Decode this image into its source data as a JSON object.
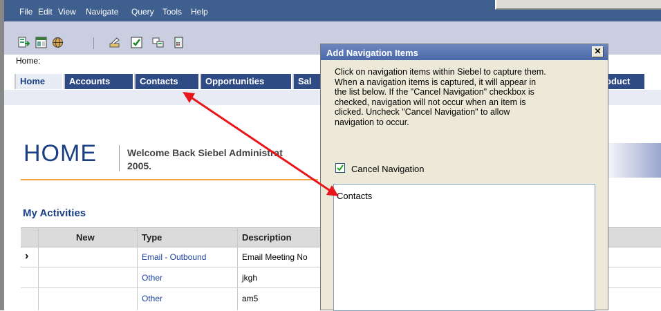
{
  "menu": {
    "items": [
      "File",
      "Edit",
      "View",
      "Navigate",
      "Query",
      "Tools",
      "Help"
    ]
  },
  "toolbar": {
    "icons": [
      "export-icon",
      "layout-icon",
      "globe-icon",
      "edit-icon",
      "checklist-icon",
      "screen-icon",
      "calculator-icon"
    ]
  },
  "breadcrumb": "Home:",
  "tabs": [
    {
      "label": "Home",
      "active": true
    },
    {
      "label": "Accounts",
      "active": false
    },
    {
      "label": "Contacts",
      "active": false
    },
    {
      "label": "Opportunities",
      "active": false
    },
    {
      "label": "Sal",
      "active": false
    },
    {
      "label": "oduct",
      "active": false
    }
  ],
  "page": {
    "title": "HOME",
    "welcome_line1": "Welcome Back Siebel Administrat",
    "welcome_line2": "2005."
  },
  "activities": {
    "title": "My Activities",
    "columns": [
      "New",
      "Type",
      "Description"
    ],
    "rows": [
      {
        "selected": "›",
        "new": "",
        "type": "Email - Outbound",
        "description": "Email Meeting No"
      },
      {
        "selected": "",
        "new": "",
        "type": "Other",
        "description": "jkgh"
      },
      {
        "selected": "",
        "new": "",
        "type": "Other",
        "description": "am5"
      }
    ]
  },
  "dialog": {
    "title": "Add Navigation Items",
    "close_label": "✕",
    "description_lines": [
      "Click on navigation items within Siebel to capture them.",
      "When a navigation items is captured, it will appear in",
      "the list below. If the \"Cancel Navigation\" checkbox is",
      "checked, navigation will not occur when an item is",
      "clicked. Uncheck \"Cancel Navigation\" to allow",
      "navigation to occur."
    ],
    "checkbox_label": "Cancel Navigation",
    "checkbox_checked": true,
    "list_items": [
      "Contacts"
    ]
  },
  "colors": {
    "menubar": "#3f5f8e",
    "tab": "#2e4b86",
    "heading": "#1b3f84",
    "arrow": "#e8151b",
    "orange_rule": "#f0a040"
  }
}
